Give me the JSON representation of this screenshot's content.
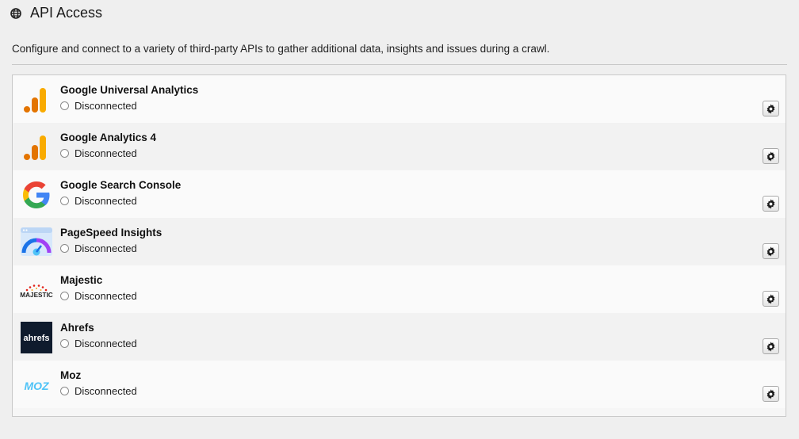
{
  "header": {
    "title": "API Access",
    "icon": "globe-icon"
  },
  "description": "Configure and connect to a variety of third-party APIs to gather additional data, insights and issues during a crawl.",
  "apis": [
    {
      "name": "Google Universal Analytics",
      "status": "Disconnected",
      "icon": "google-analytics-icon",
      "settings_icon": "gear-icon"
    },
    {
      "name": "Google Analytics 4",
      "status": "Disconnected",
      "icon": "google-analytics-4-icon",
      "settings_icon": "gear-icon"
    },
    {
      "name": "Google Search Console",
      "status": "Disconnected",
      "icon": "google-g-icon",
      "settings_icon": "gear-icon"
    },
    {
      "name": "PageSpeed Insights",
      "status": "Disconnected",
      "icon": "pagespeed-icon",
      "settings_icon": "gear-icon"
    },
    {
      "name": "Majestic",
      "status": "Disconnected",
      "icon": "majestic-logo",
      "logo_text": "MAJESTIC",
      "settings_icon": "gear-icon"
    },
    {
      "name": "Ahrefs",
      "status": "Disconnected",
      "icon": "ahrefs-logo",
      "logo_text": "ahrefs",
      "settings_icon": "gear-icon"
    },
    {
      "name": "Moz",
      "status": "Disconnected",
      "icon": "moz-logo",
      "logo_text": "MOZ",
      "settings_icon": "gear-icon"
    }
  ],
  "colors": {
    "analytics_orange": "#F9AB00",
    "analytics_dark_orange": "#E37400",
    "ahrefs_bg": "#0f1b2d",
    "ahrefs_accent": "#ff8800",
    "moz_blue": "#4fc3f7",
    "majestic_red": "#e2231a"
  }
}
